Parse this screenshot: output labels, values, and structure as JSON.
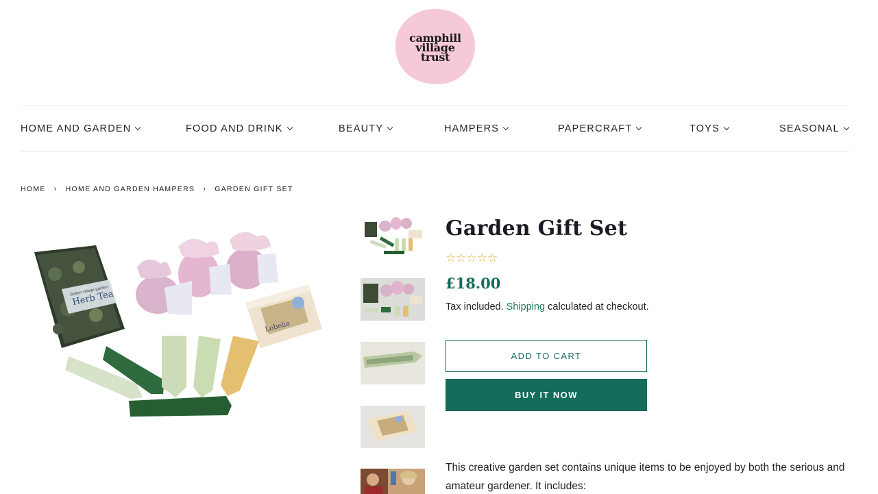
{
  "logo": {
    "line1": "camphill",
    "line2": "village",
    "line3": "trust",
    "bg_color": "#f6c9d6"
  },
  "nav": [
    {
      "label": "HOME AND GARDEN"
    },
    {
      "label": "FOOD AND DRINK"
    },
    {
      "label": "BEAUTY"
    },
    {
      "label": "HAMPERS"
    },
    {
      "label": "PAPERCRAFT"
    },
    {
      "label": "TOYS"
    },
    {
      "label": "SEASONAL"
    }
  ],
  "breadcrumb": {
    "home": "HOME",
    "category": "HOME AND GARDEN HAMPERS",
    "current": "GARDEN GIFT SET",
    "separator": "›"
  },
  "product": {
    "title": "Garden Gift Set",
    "rating_stars": "☆☆☆☆☆",
    "rating": 0,
    "price": "£18.00",
    "tax_prefix": "Tax included.",
    "shipping_link": "Shipping",
    "tax_suffix": "calculated at checkout.",
    "add_to_cart": "ADD TO CART",
    "buy_now": "BUY IT NOW",
    "description": "This creative garden set contains unique items to be enjoyed by both the serious and amateur gardener. It includes:"
  },
  "images": {
    "main": {
      "tea_label_brand": "Botton village garden",
      "tea_label": "Herb Tea",
      "soap_label": "Lobelia"
    }
  },
  "colors": {
    "accent": "#146c5a",
    "star": "#e0b341",
    "logo_pink": "#f6c9d6"
  }
}
